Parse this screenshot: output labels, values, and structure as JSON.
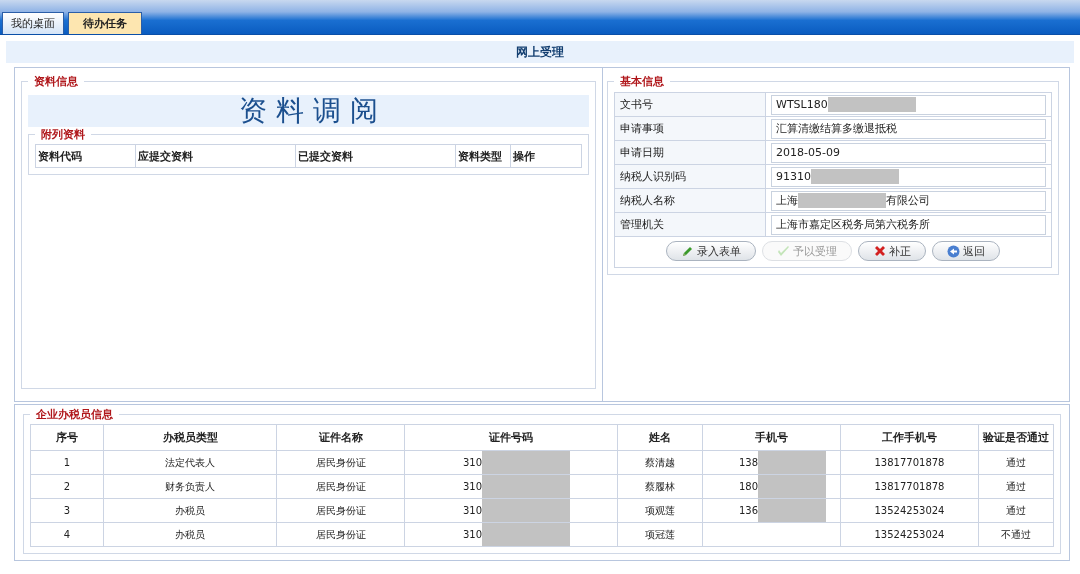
{
  "tabs": [
    {
      "label": "我的桌面",
      "selected": false
    },
    {
      "label": "待办任务",
      "selected": true
    }
  ],
  "page_title": "网上受理",
  "material_info": {
    "legend": "资料信息",
    "banner": "资 料 调 阅",
    "attached": {
      "legend": "附列资料",
      "columns": [
        "资料代码",
        "应提交资料",
        "已提交资料",
        "资料类型",
        "操作"
      ]
    }
  },
  "basic_info": {
    "legend": "基本信息",
    "fields": [
      {
        "label": "文书号",
        "value": "WTSL180",
        "redacted": true
      },
      {
        "label": "申请事项",
        "value": "汇算清缴结算多缴退抵税",
        "redacted": false
      },
      {
        "label": "申请日期",
        "value": "2018-05-09",
        "redacted": false
      },
      {
        "label": "纳税人识别码",
        "value": "91310",
        "redacted": true
      },
      {
        "label": "纳税人名称",
        "value": "上海",
        "value_after": "有限公司",
        "redacted": true
      },
      {
        "label": "管理机关",
        "value": "上海市嘉定区税务局第六税务所",
        "redacted": false
      }
    ],
    "buttons": [
      {
        "label": "录入表单",
        "disabled": false
      },
      {
        "label": "予以受理",
        "disabled": true
      },
      {
        "label": "补正",
        "disabled": false
      },
      {
        "label": "返回",
        "disabled": false
      }
    ]
  },
  "agents": {
    "legend": "企业办税员信息",
    "columns": [
      "序号",
      "办税员类型",
      "证件名称",
      "证件号码",
      "姓名",
      "手机号",
      "工作手机号",
      "验证是否通过"
    ],
    "rows": [
      {
        "no": "1",
        "type": "法定代表人",
        "id_type": "居民身份证",
        "id_number": "310",
        "name": "蔡清越",
        "mobile": "138",
        "mobile_redacted": true,
        "work_mobile": "13817701878",
        "verified": "通过"
      },
      {
        "no": "2",
        "type": "财务负责人",
        "id_type": "居民身份证",
        "id_number": "310",
        "name": "蔡履林",
        "mobile": "180",
        "mobile_redacted": true,
        "work_mobile": "13817701878",
        "verified": "通过"
      },
      {
        "no": "3",
        "type": "办税员",
        "id_type": "居民身份证",
        "id_number": "310",
        "name": "项观莲",
        "mobile": "136",
        "mobile_redacted": true,
        "work_mobile": "13524253024",
        "verified": "通过"
      },
      {
        "no": "4",
        "type": "办税员",
        "id_type": "居民身份证",
        "id_number": "310",
        "name": "项冠莲",
        "mobile_redacted": false,
        "work_mobile": "13524253024",
        "verified": "不通过"
      }
    ]
  }
}
